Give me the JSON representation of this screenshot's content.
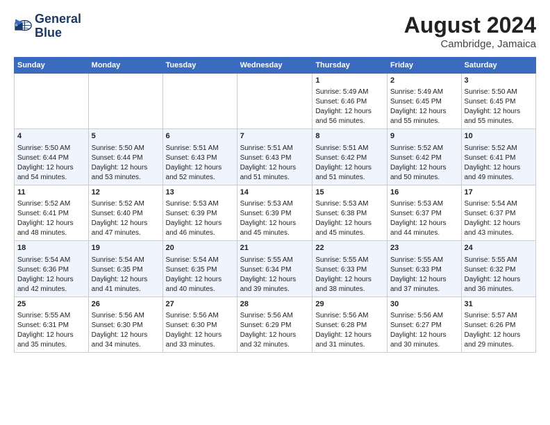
{
  "logo": {
    "line1": "General",
    "line2": "Blue"
  },
  "title": "August 2024",
  "subtitle": "Cambridge, Jamaica",
  "days_of_week": [
    "Sunday",
    "Monday",
    "Tuesday",
    "Wednesday",
    "Thursday",
    "Friday",
    "Saturday"
  ],
  "weeks": [
    [
      {
        "day": "",
        "content": ""
      },
      {
        "day": "",
        "content": ""
      },
      {
        "day": "",
        "content": ""
      },
      {
        "day": "",
        "content": ""
      },
      {
        "day": "1",
        "content": "Sunrise: 5:49 AM\nSunset: 6:46 PM\nDaylight: 12 hours\nand 56 minutes."
      },
      {
        "day": "2",
        "content": "Sunrise: 5:49 AM\nSunset: 6:45 PM\nDaylight: 12 hours\nand 55 minutes."
      },
      {
        "day": "3",
        "content": "Sunrise: 5:50 AM\nSunset: 6:45 PM\nDaylight: 12 hours\nand 55 minutes."
      }
    ],
    [
      {
        "day": "4",
        "content": "Sunrise: 5:50 AM\nSunset: 6:44 PM\nDaylight: 12 hours\nand 54 minutes."
      },
      {
        "day": "5",
        "content": "Sunrise: 5:50 AM\nSunset: 6:44 PM\nDaylight: 12 hours\nand 53 minutes."
      },
      {
        "day": "6",
        "content": "Sunrise: 5:51 AM\nSunset: 6:43 PM\nDaylight: 12 hours\nand 52 minutes."
      },
      {
        "day": "7",
        "content": "Sunrise: 5:51 AM\nSunset: 6:43 PM\nDaylight: 12 hours\nand 51 minutes."
      },
      {
        "day": "8",
        "content": "Sunrise: 5:51 AM\nSunset: 6:42 PM\nDaylight: 12 hours\nand 51 minutes."
      },
      {
        "day": "9",
        "content": "Sunrise: 5:52 AM\nSunset: 6:42 PM\nDaylight: 12 hours\nand 50 minutes."
      },
      {
        "day": "10",
        "content": "Sunrise: 5:52 AM\nSunset: 6:41 PM\nDaylight: 12 hours\nand 49 minutes."
      }
    ],
    [
      {
        "day": "11",
        "content": "Sunrise: 5:52 AM\nSunset: 6:41 PM\nDaylight: 12 hours\nand 48 minutes."
      },
      {
        "day": "12",
        "content": "Sunrise: 5:52 AM\nSunset: 6:40 PM\nDaylight: 12 hours\nand 47 minutes."
      },
      {
        "day": "13",
        "content": "Sunrise: 5:53 AM\nSunset: 6:39 PM\nDaylight: 12 hours\nand 46 minutes."
      },
      {
        "day": "14",
        "content": "Sunrise: 5:53 AM\nSunset: 6:39 PM\nDaylight: 12 hours\nand 45 minutes."
      },
      {
        "day": "15",
        "content": "Sunrise: 5:53 AM\nSunset: 6:38 PM\nDaylight: 12 hours\nand 45 minutes."
      },
      {
        "day": "16",
        "content": "Sunrise: 5:53 AM\nSunset: 6:37 PM\nDaylight: 12 hours\nand 44 minutes."
      },
      {
        "day": "17",
        "content": "Sunrise: 5:54 AM\nSunset: 6:37 PM\nDaylight: 12 hours\nand 43 minutes."
      }
    ],
    [
      {
        "day": "18",
        "content": "Sunrise: 5:54 AM\nSunset: 6:36 PM\nDaylight: 12 hours\nand 42 minutes."
      },
      {
        "day": "19",
        "content": "Sunrise: 5:54 AM\nSunset: 6:35 PM\nDaylight: 12 hours\nand 41 minutes."
      },
      {
        "day": "20",
        "content": "Sunrise: 5:54 AM\nSunset: 6:35 PM\nDaylight: 12 hours\nand 40 minutes."
      },
      {
        "day": "21",
        "content": "Sunrise: 5:55 AM\nSunset: 6:34 PM\nDaylight: 12 hours\nand 39 minutes."
      },
      {
        "day": "22",
        "content": "Sunrise: 5:55 AM\nSunset: 6:33 PM\nDaylight: 12 hours\nand 38 minutes."
      },
      {
        "day": "23",
        "content": "Sunrise: 5:55 AM\nSunset: 6:33 PM\nDaylight: 12 hours\nand 37 minutes."
      },
      {
        "day": "24",
        "content": "Sunrise: 5:55 AM\nSunset: 6:32 PM\nDaylight: 12 hours\nand 36 minutes."
      }
    ],
    [
      {
        "day": "25",
        "content": "Sunrise: 5:55 AM\nSunset: 6:31 PM\nDaylight: 12 hours\nand 35 minutes."
      },
      {
        "day": "26",
        "content": "Sunrise: 5:56 AM\nSunset: 6:30 PM\nDaylight: 12 hours\nand 34 minutes."
      },
      {
        "day": "27",
        "content": "Sunrise: 5:56 AM\nSunset: 6:30 PM\nDaylight: 12 hours\nand 33 minutes."
      },
      {
        "day": "28",
        "content": "Sunrise: 5:56 AM\nSunset: 6:29 PM\nDaylight: 12 hours\nand 32 minutes."
      },
      {
        "day": "29",
        "content": "Sunrise: 5:56 AM\nSunset: 6:28 PM\nDaylight: 12 hours\nand 31 minutes."
      },
      {
        "day": "30",
        "content": "Sunrise: 5:56 AM\nSunset: 6:27 PM\nDaylight: 12 hours\nand 30 minutes."
      },
      {
        "day": "31",
        "content": "Sunrise: 5:57 AM\nSunset: 6:26 PM\nDaylight: 12 hours\nand 29 minutes."
      }
    ]
  ]
}
